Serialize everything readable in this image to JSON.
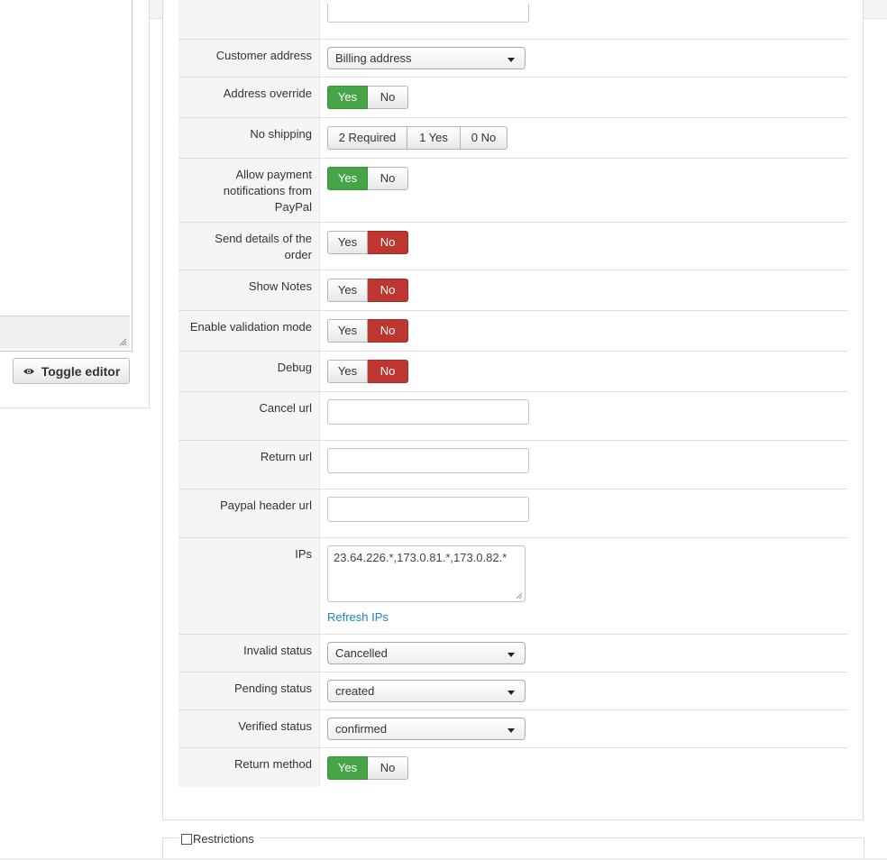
{
  "editor": {
    "toggle_label": "Toggle editor"
  },
  "settings": {
    "customer_address": {
      "label": "Customer address",
      "value": "Billing address"
    },
    "address_override": {
      "label": "Address override",
      "yes": "Yes",
      "no": "No",
      "selected": "Yes"
    },
    "no_shipping": {
      "label": "No shipping",
      "options": [
        "2 Required",
        "1 Yes",
        "0 No"
      ]
    },
    "allow_notifications": {
      "label_lines": [
        "Allow payment",
        "notifications from",
        "PayPal"
      ],
      "yes": "Yes",
      "no": "No",
      "selected": "Yes"
    },
    "send_details": {
      "label_lines": [
        "Send details of the",
        "order"
      ],
      "yes": "Yes",
      "no": "No",
      "selected": "No"
    },
    "show_notes": {
      "label": "Show Notes",
      "yes": "Yes",
      "no": "No",
      "selected": "No"
    },
    "validation_mode": {
      "label": "Enable validation mode",
      "yes": "Yes",
      "no": "No",
      "selected": "No"
    },
    "debug": {
      "label": "Debug",
      "yes": "Yes",
      "no": "No",
      "selected": "No"
    },
    "cancel_url": {
      "label": "Cancel url",
      "value": ""
    },
    "return_url": {
      "label": "Return url",
      "value": ""
    },
    "header_url": {
      "label": "Paypal header url",
      "value": ""
    },
    "ips": {
      "label": "IPs",
      "value": "23.64.226.*,173.0.81.*,173.0.82.*",
      "refresh_link": "Refresh IPs"
    },
    "invalid_status": {
      "label": "Invalid status",
      "value": "Cancelled"
    },
    "pending_status": {
      "label": "Pending status",
      "value": "created"
    },
    "verified_status": {
      "label": "Verified status",
      "value": "confirmed"
    },
    "return_method": {
      "label": "Return method",
      "yes": "Yes",
      "no": "No",
      "selected": "Yes"
    }
  },
  "restrictions": {
    "legend": "Restrictions"
  },
  "colors": {
    "yes_active": "#46a546",
    "no_active": "#bd362f",
    "link": "#1a84c6"
  }
}
